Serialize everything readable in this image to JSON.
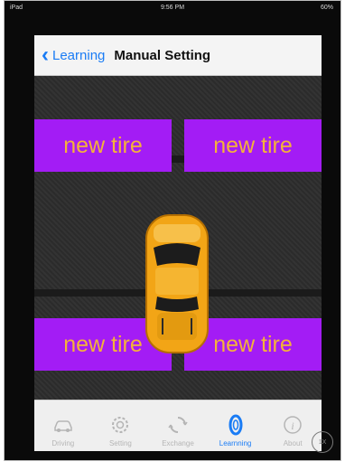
{
  "status": {
    "left": "iPad",
    "time": "9:56 PM",
    "right": "60%"
  },
  "nav": {
    "back_label": "Learning",
    "title": "Manual Setting"
  },
  "tires": [
    "new tire",
    "new tire",
    "new tire",
    "new tire"
  ],
  "tabs": [
    {
      "label": "Driving",
      "icon": "car-icon"
    },
    {
      "label": "Setting",
      "icon": "gear-icon"
    },
    {
      "label": "Exchange",
      "icon": "exchange-icon"
    },
    {
      "label": "Learnning",
      "icon": "tire-icon",
      "active": true
    },
    {
      "label": "About",
      "icon": "info-icon"
    }
  ],
  "zoom_badge": "1X",
  "colors": {
    "accent": "#1a7cf5",
    "tire_bg": "#a31cf5",
    "tire_text": "#f4b23a",
    "car": "#f2a516"
  }
}
